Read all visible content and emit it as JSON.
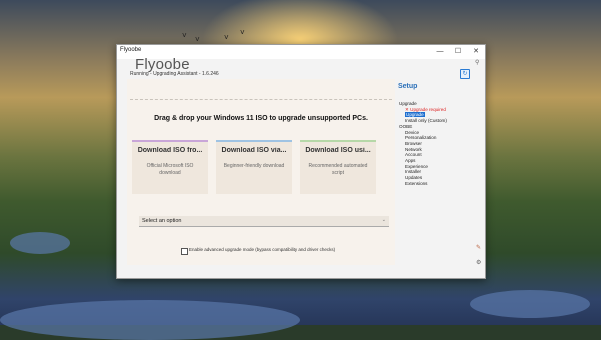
{
  "window": {
    "title": "Flyoobe",
    "app_name": "Flyoobe",
    "status": "Running - Upgrading Assistant - 1.6.246",
    "controls": {
      "minimize": "—",
      "maximize": "☐",
      "close": "✕"
    }
  },
  "main": {
    "drag_text": "Drag & drop your Windows 11 ISO to upgrade unsupported PCs.",
    "cards": [
      {
        "title": "Download ISO fro...",
        "desc": "Official Microsoft ISO download",
        "color": "#c9a6d8"
      },
      {
        "title": "Download ISO via...",
        "desc": "Beginner-friendly download",
        "color": "#9fc3e3"
      },
      {
        "title": "Download ISO usi...",
        "desc": "Recommended automated script",
        "color": "#b6d8a8"
      }
    ],
    "select": {
      "value": "Select an option",
      "arrow": "⌄"
    },
    "advanced_label": "Enable advanced upgrade mode (bypass compatibility and driver checks)"
  },
  "sidebar": {
    "title": "Setup",
    "tree": {
      "upgrade": "Upgrade",
      "upgrade_required": "✕ Upgrade required",
      "upgrade_item": "Upgrade",
      "install_only": "Install only (Custom)",
      "oobe": "OOBE",
      "oobe_items": [
        "Device",
        "Personalization",
        "Browser",
        "Network",
        "Account",
        "Apps",
        "Experience",
        "Installer",
        "Updates",
        "Extensions"
      ]
    }
  },
  "icons": {
    "refresh": "↻",
    "search": "⚲",
    "chevron": "⌄"
  },
  "colors": {
    "accent": "#2a6fb8",
    "selected": "#1e6fd0",
    "error": "#d22222"
  }
}
